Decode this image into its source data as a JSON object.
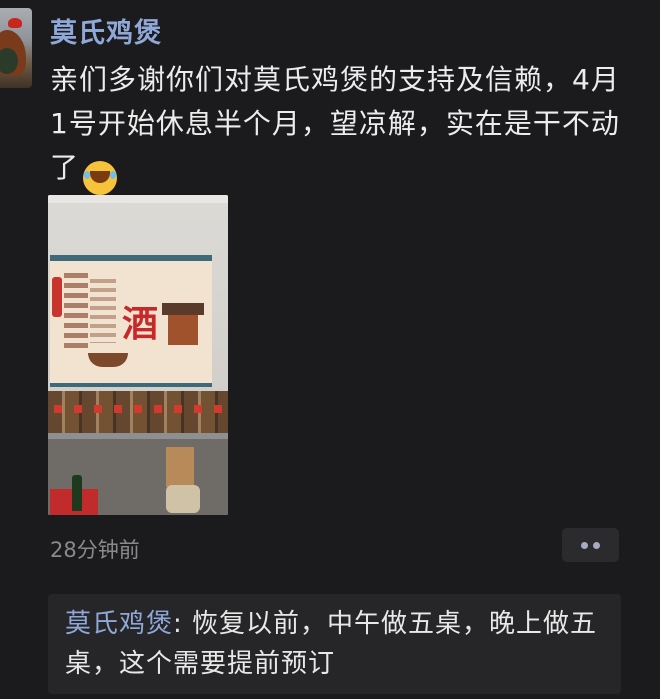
{
  "post": {
    "author": "莫氏鸡煲",
    "text": "亲们多谢你们对莫氏鸡煲的支持及信赖，4月1号开始休息半个月，望凉解，实在是干不动了",
    "emoji": "😂",
    "image_sign_text": "酒",
    "time": "28分钟前"
  },
  "comments": [
    {
      "name": "莫氏鸡煲",
      "separator": ": ",
      "text": "恢复以前，中午做五桌，晚上做五桌，这个需要提前预订"
    }
  ],
  "icons": {
    "more": "more-dots-icon",
    "emoji": "laughing-tears-emoji-icon"
  },
  "colors": {
    "background": "#1b1b1d",
    "name_link": "#8fa8d8",
    "comment_bg": "#262628",
    "muted_text": "#8a8a8e"
  }
}
